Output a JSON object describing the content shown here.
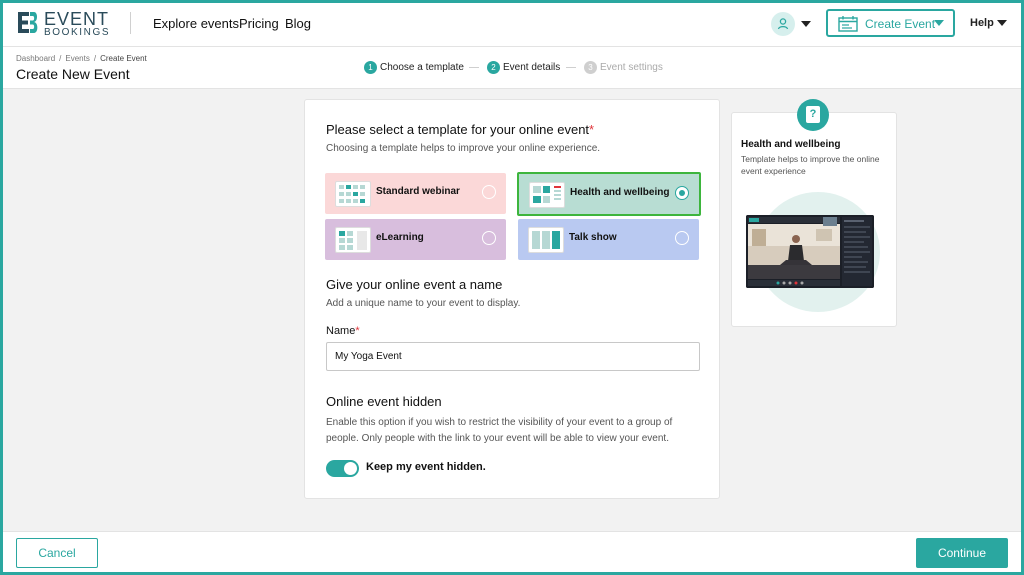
{
  "brand": {
    "line1": "EVENT",
    "line2": "BOOKINGS"
  },
  "nav": {
    "explore": "Explore events",
    "pricing": "Pricing",
    "blog": "Blog"
  },
  "header": {
    "create_event": "Create Event",
    "help": "Help"
  },
  "breadcrumb": {
    "items": [
      "Dashboard",
      "Events",
      "Create Event"
    ],
    "separator": "/"
  },
  "page_title": "Create New Event",
  "steps": [
    {
      "num": "1",
      "label": "Choose a template"
    },
    {
      "num": "2",
      "label": "Event details"
    },
    {
      "num": "3",
      "label": "Event settings"
    }
  ],
  "template_section": {
    "title": "Please select a template for your online event",
    "required_mark": "*",
    "subtitle": "Choosing a template helps to improve your online experience."
  },
  "templates": [
    {
      "label": "Standard webinar",
      "color": "#fbd8d8"
    },
    {
      "label": "Health and wellbeing",
      "color": "#b8ddd3"
    },
    {
      "label": "eLearning",
      "color": "#d8bedd"
    },
    {
      "label": "Talk show",
      "color": "#b9c9f1"
    }
  ],
  "selected_template": "Health and wellbeing",
  "name_section": {
    "title": "Give your online event a name",
    "subtitle": "Add a unique name to your event to display.",
    "field_label": "Name",
    "required_mark": "*",
    "value": "My Yoga Event"
  },
  "hidden_section": {
    "title": "Online event hidden",
    "description": "Enable this option if you wish to restrict the visibility of your event to a group of people. Only people with the link to your event will be able to view your event.",
    "toggle_label": "Keep my event hidden.",
    "toggle_on": true
  },
  "preview": {
    "title": "Health and wellbeing",
    "description": "Template helps to improve the online event experience",
    "badge_icon": "question-icon"
  },
  "footer": {
    "cancel": "Cancel",
    "continue": "Continue"
  },
  "colors": {
    "accent": "#2aa7a0",
    "selected_border": "#3db53d",
    "required": "#e0343a"
  }
}
